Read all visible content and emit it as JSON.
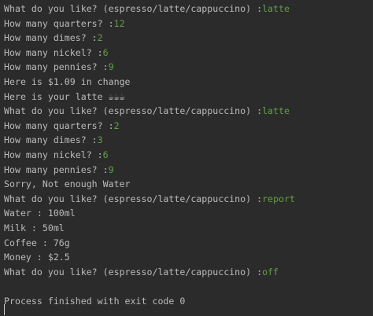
{
  "console": {
    "lines": [
      {
        "prompt": "What do you like? (espresso/latte/cappuccino) :",
        "input": "latte"
      },
      {
        "prompt": "How many quarters? :",
        "input": "12"
      },
      {
        "prompt": "How many dimes? :",
        "input": "2"
      },
      {
        "prompt": "How many nickel? :",
        "input": "6"
      },
      {
        "prompt": "How many pennies? :",
        "input": "9"
      },
      {
        "text": "Here is $1.09 in change"
      },
      {
        "text": "Here is your latte ☕☕☕"
      },
      {
        "prompt": "What do you like? (espresso/latte/cappuccino) :",
        "input": "latte"
      },
      {
        "prompt": "How many quarters? :",
        "input": "2"
      },
      {
        "prompt": "How many dimes? :",
        "input": "3"
      },
      {
        "prompt": "How many nickel? :",
        "input": "6"
      },
      {
        "prompt": "How many pennies? :",
        "input": "9"
      },
      {
        "text": "Sorry, Not enough Water"
      },
      {
        "prompt": "What do you like? (espresso/latte/cappuccino) :",
        "input": "report"
      },
      {
        "text": "Water : 100ml"
      },
      {
        "text": "Milk : 50ml"
      },
      {
        "text": "Coffee : 76g"
      },
      {
        "text": "Money : $2.5"
      },
      {
        "prompt": "What do you like? (espresso/latte/cappuccino) :",
        "input": "off"
      },
      {
        "text": ""
      },
      {
        "text": "Process finished with exit code 0"
      }
    ]
  },
  "colors": {
    "background": "#2b2b2b",
    "output_text": "#bbbbbb",
    "user_input": "#62a044"
  }
}
